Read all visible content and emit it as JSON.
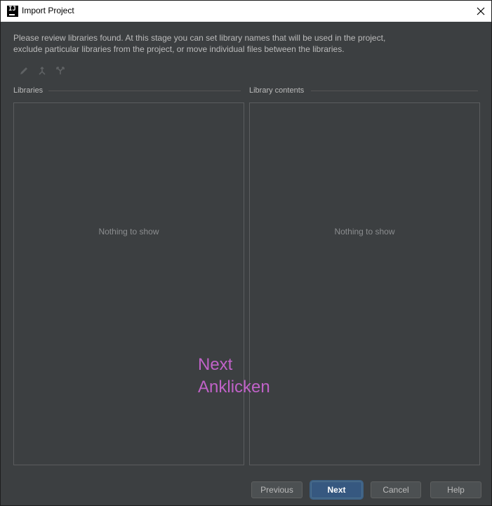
{
  "window": {
    "title": "Import Project",
    "app_icon_text": "IJ",
    "close_icon": "close-icon"
  },
  "description": {
    "line1": "Please review libraries found. At this stage you can set library names that will be used in the project,",
    "line2": "exclude particular libraries from the project, or move individual files between the libraries."
  },
  "toolbar": {
    "icons": [
      "edit-icon",
      "merge-icon",
      "split-icon"
    ]
  },
  "libraries": {
    "label": "Libraries",
    "empty_text": "Nothing to show"
  },
  "library_contents": {
    "label": "Library contents",
    "empty_text": "Nothing to show"
  },
  "annotation": {
    "line1": "Next",
    "line2": "Anklicken",
    "color": "#c062c8"
  },
  "buttons": {
    "previous": "Previous",
    "next": "Next",
    "cancel": "Cancel",
    "help": "Help"
  },
  "colors": {
    "background": "#3c3f41",
    "primary_button": "#365880"
  }
}
